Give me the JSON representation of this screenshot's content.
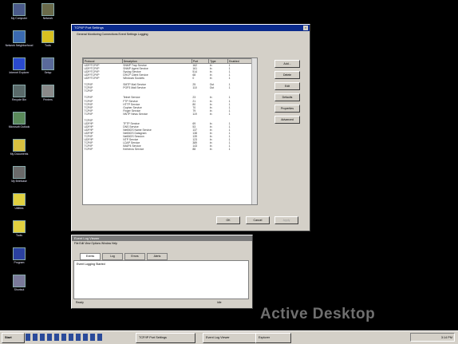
{
  "desktop": {
    "icons": [
      {
        "name": "desktop-icon-my-computer",
        "glyph_color": "#4a5a8a",
        "label": "My Computer"
      },
      {
        "name": "desktop-icon-network",
        "glyph_color": "#3a6ab0",
        "label": "Network Neighborhood"
      },
      {
        "name": "desktop-icon-internet",
        "glyph_color": "#2a4acf",
        "label": "Internet Explorer"
      },
      {
        "name": "desktop-icon-recycle",
        "glyph_color": "#5a6a6a",
        "label": "Recycle Bin"
      },
      {
        "name": "desktop-icon-shortcut-1",
        "glyph_color": "#5a8a5a",
        "label": "Microsoft Outlook"
      },
      {
        "name": "desktop-icon-folder-1",
        "glyph_color": "#d8c040",
        "label": "My Documents"
      },
      {
        "name": "desktop-icon-briefcase",
        "glyph_color": "#6a6a6a",
        "label": "My Briefcase"
      },
      {
        "name": "desktop-icon-folder-2",
        "glyph_color": "#e0d040",
        "label": "Utilities"
      },
      {
        "name": "desktop-icon-folder-3",
        "glyph_color": "#e0d040",
        "label": "Tools"
      },
      {
        "name": "desktop-icon-program",
        "glyph_color": "#2a40a0",
        "label": "Program"
      },
      {
        "name": "desktop-icon-shortcut-2",
        "glyph_color": "#7a7a9a",
        "label": "Shortcut"
      }
    ],
    "icons_col2": [
      {
        "name": "desktop-icon-2-1",
        "glyph_color": "#6a6a4a",
        "label": "Network"
      },
      {
        "name": "desktop-icon-2-2",
        "glyph_color": "#d8c020",
        "label": "Tools"
      },
      {
        "name": "desktop-icon-2-3",
        "glyph_color": "#5a6a9a",
        "label": "Setup"
      },
      {
        "name": "desktop-icon-2-4",
        "glyph_color": "#8a8a8a",
        "label": "Printers"
      }
    ],
    "wallpaper_text": "Active Desktop"
  },
  "main_dialog": {
    "title": "TCP/IP Port Settings",
    "close_glyph": "×",
    "tabs": "General  Monitoring  Connections  Event Settings  Logging",
    "columns": [
      "Protocol",
      "Description",
      "Port",
      "Type",
      "Enabled"
    ],
    "rows": [
      [
        "UDP/TCP/IP",
        "SNMP Trap Service",
        "162",
        "In",
        "1"
      ],
      [
        "UDP/TCP/IP",
        "SNMP Agent Service",
        "161",
        "In",
        "1"
      ],
      [
        "UDP/TCP/IP",
        "Syslog Service",
        "514",
        "In",
        "1"
      ],
      [
        "UDP/TCP/IP",
        "DHCP Client Service",
        "68",
        "In",
        "1"
      ],
      [
        "UDP/TCP/IP",
        "Windows Sockets",
        "0",
        "In",
        "1"
      ],
      [
        "",
        "",
        "",
        "",
        ""
      ],
      [
        "TCP/IP",
        "SMTP Mail Service",
        "25",
        "Out",
        "1"
      ],
      [
        "TCP/IP",
        "POP3 Mail Service",
        "110",
        "Out",
        "1"
      ],
      [
        "TCP/IP",
        "",
        "",
        "",
        ""
      ],
      [
        "",
        "",
        "",
        "",
        ""
      ],
      [
        "TCP/IP",
        "Telnet Service",
        "23",
        "In",
        "1"
      ],
      [
        "TCP/IP",
        "FTP Service",
        "21",
        "In",
        "1"
      ],
      [
        "TCP/IP",
        "HTTP Service",
        "80",
        "In",
        "1"
      ],
      [
        "TCP/IP",
        "Gopher Service",
        "70",
        "In",
        "1"
      ],
      [
        "TCP/IP",
        "Finger Service",
        "79",
        "In",
        "1"
      ],
      [
        "TCP/IP",
        "NNTP News Service",
        "119",
        "In",
        "1"
      ],
      [
        "",
        "",
        "",
        "",
        ""
      ],
      [
        "TCP/IP",
        "",
        "",
        "",
        ""
      ],
      [
        "UDP/IP",
        "TFTP Service",
        "69",
        "In",
        "1"
      ],
      [
        "UDP/IP",
        "DNS Service",
        "53",
        "In",
        "1"
      ],
      [
        "UDP/IP",
        "NetBIOS Name Service",
        "137",
        "In",
        "1"
      ],
      [
        "UDP/IP",
        "NetBIOS Datagram",
        "138",
        "In",
        "1"
      ],
      [
        "TCP/IP",
        "NetBIOS Session",
        "139",
        "In",
        "1"
      ],
      [
        "UDP/IP",
        "NTP Service",
        "123",
        "In",
        "1"
      ],
      [
        "TCP/IP",
        "LDAP Service",
        "389",
        "In",
        "1"
      ],
      [
        "TCP/IP",
        "IMAP4 Service",
        "143",
        "In",
        "1"
      ],
      [
        "TCP/IP",
        "Kerberos Service",
        "88",
        "In",
        "1"
      ]
    ],
    "side_buttons": [
      "Add...",
      "Delete",
      "Edit",
      "Defaults",
      "Properties",
      "Advanced"
    ],
    "ok": "OK",
    "cancel": "Cancel",
    "apply": "Apply"
  },
  "log_window": {
    "title": "Event Log Viewer",
    "menu": "File  Edit  View  Options  Window  Help",
    "tabs": [
      "Events",
      "Log",
      "Errors",
      "Alerts"
    ],
    "body_text": "Event Logging Started",
    "status_left": "Ready",
    "status_right": "Idle"
  },
  "taskbar": {
    "start": "Start",
    "task1": "TCP/IP Port Settings",
    "task2": "Event Log Viewer",
    "task3": "Explorer",
    "clock": "3:14 PM"
  },
  "colors": {
    "desktop": "#000000",
    "titlebar": "#0a2a8c",
    "face": "#d4d0c8"
  }
}
